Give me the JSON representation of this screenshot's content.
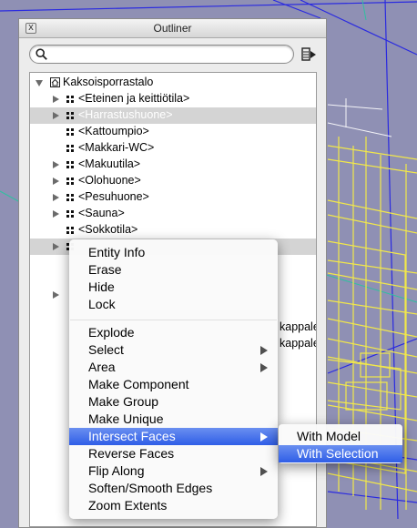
{
  "window": {
    "title": "Outliner",
    "close_symbol": "x"
  },
  "search": {
    "value": "",
    "placeholder": ""
  },
  "tree": {
    "root": "Kaksoisporrastalo",
    "items": [
      {
        "label": "<Eteinen ja keittiötila>",
        "expandable": true,
        "selected": false
      },
      {
        "label": "<Harrastushuone>",
        "expandable": true,
        "selected": true
      },
      {
        "label": "<Kattoumpio>",
        "expandable": false,
        "selected": false
      },
      {
        "label": "<Makkari-WC>",
        "expandable": false,
        "selected": false
      },
      {
        "label": "<Makuutila>",
        "expandable": true,
        "selected": false
      },
      {
        "label": "<Olohuone>",
        "expandable": true,
        "selected": false
      },
      {
        "label": "<Pesuhuone>",
        "expandable": true,
        "selected": false
      },
      {
        "label": "<Sauna>",
        "expandable": true,
        "selected": false
      },
      {
        "label": "<Sokkotila>",
        "expandable": false,
        "selected": false
      },
      {
        "label": "",
        "expandable": true,
        "selected": true
      }
    ],
    "obscured_rows": [
      "kappale",
      "kappale"
    ]
  },
  "context_menu": {
    "group1": [
      "Entity Info",
      "Erase",
      "Hide",
      "Lock"
    ],
    "group2": [
      {
        "label": "Explode",
        "submenu": false,
        "highlighted": false
      },
      {
        "label": "Select",
        "submenu": true,
        "highlighted": false
      },
      {
        "label": "Area",
        "submenu": true,
        "highlighted": false
      },
      {
        "label": "Make Component",
        "submenu": false,
        "highlighted": false
      },
      {
        "label": "Make Group",
        "submenu": false,
        "highlighted": false
      },
      {
        "label": "Make Unique",
        "submenu": false,
        "highlighted": false
      },
      {
        "label": "Intersect Faces",
        "submenu": true,
        "highlighted": true
      },
      {
        "label": "Reverse Faces",
        "submenu": false,
        "highlighted": false
      },
      {
        "label": "Flip Along",
        "submenu": true,
        "highlighted": false
      },
      {
        "label": "Soften/Smooth Edges",
        "submenu": false,
        "highlighted": false
      },
      {
        "label": "Zoom Extents",
        "submenu": false,
        "highlighted": false
      }
    ]
  },
  "submenu": {
    "items": [
      "With Model",
      "With Selection"
    ],
    "highlighted_index": 1
  },
  "colors": {
    "viewport_bg": "#8f90b4",
    "wireframe_yellow": "#f2e84a",
    "wireframe_blue": "#2020e0",
    "highlight_blue": "#3a66ea"
  }
}
